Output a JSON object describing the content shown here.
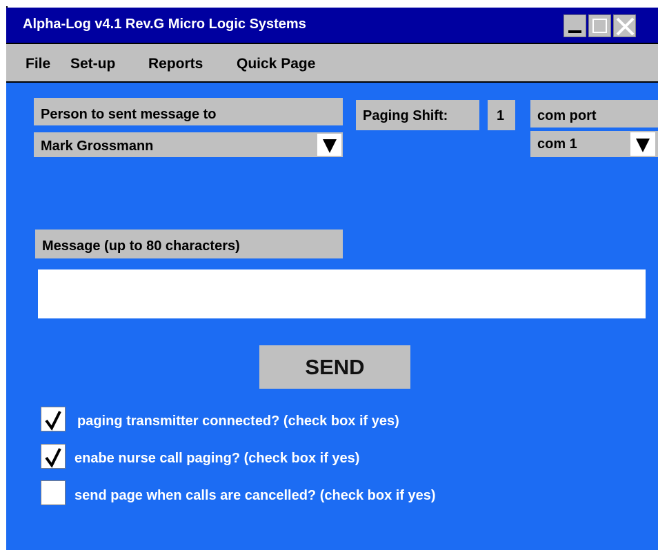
{
  "window": {
    "title": "Alpha-Log  v4.1 Rev.G  Micro Logic Systems"
  },
  "menu": [
    "File",
    "Set-up",
    "Reports",
    "Quick Page"
  ],
  "recipient": {
    "label": "Person to sent message to",
    "selected": "Mark Grossmann"
  },
  "paging_shift": {
    "label": "Paging Shift:",
    "value": "1"
  },
  "com_port": {
    "label": "com port",
    "selected": "com 1"
  },
  "message": {
    "label": "Message (up to 80 characters)",
    "value": ""
  },
  "send_label": "SEND",
  "options": [
    {
      "label": "paging transmitter connected? (check box if yes)",
      "checked": true
    },
    {
      "label": "enabe nurse call paging? (check box if yes)",
      "checked": true
    },
    {
      "label": "send page when calls are cancelled? (check box if yes)",
      "checked": false
    }
  ],
  "colors": {
    "titlebar": "#0000a0",
    "client": "#1c6cf3",
    "panel": "#c0c0c0"
  }
}
